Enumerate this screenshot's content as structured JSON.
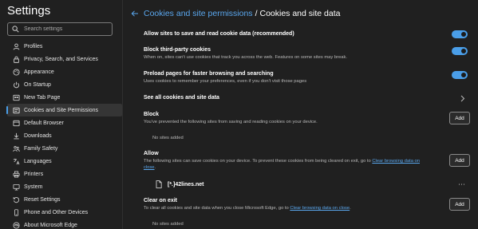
{
  "sidebar": {
    "title": "Settings",
    "search": {
      "placeholder": "Search settings",
      "value": ""
    },
    "items": [
      {
        "label": "Profiles",
        "icon": "profile-icon",
        "active": false
      },
      {
        "label": "Privacy, Search, and Services",
        "icon": "lock-icon",
        "active": false
      },
      {
        "label": "Appearance",
        "icon": "palette-icon",
        "active": false
      },
      {
        "label": "On Startup",
        "icon": "power-icon",
        "active": false
      },
      {
        "label": "New Tab Page",
        "icon": "new-tab-icon",
        "active": false
      },
      {
        "label": "Cookies and Site Permissions",
        "icon": "site-permissions-icon",
        "active": true
      },
      {
        "label": "Default Browser",
        "icon": "browser-icon",
        "active": false
      },
      {
        "label": "Downloads",
        "icon": "download-icon",
        "active": false
      },
      {
        "label": "Family Safety",
        "icon": "family-icon",
        "active": false
      },
      {
        "label": "Languages",
        "icon": "languages-icon",
        "active": false
      },
      {
        "label": "Printers",
        "icon": "printer-icon",
        "active": false
      },
      {
        "label": "System",
        "icon": "system-icon",
        "active": false
      },
      {
        "label": "Reset Settings",
        "icon": "reset-icon",
        "active": false
      },
      {
        "label": "Phone and Other Devices",
        "icon": "phone-icon",
        "active": false
      },
      {
        "label": "About Microsoft Edge",
        "icon": "edge-icon",
        "active": false
      }
    ]
  },
  "header": {
    "parent": "Cookies and site permissions",
    "separator": "/",
    "current": "Cookies and site data"
  },
  "settings": {
    "allow_save": {
      "title": "Allow sites to save and read cookie data (recommended)",
      "enabled": true
    },
    "block_third_party": {
      "title": "Block third-party cookies",
      "desc": "When on, sites can't use cookies that track you across the web. Features on some sites may break.",
      "enabled": true
    },
    "preload": {
      "title": "Preload pages for faster browsing and searching",
      "desc": "Uses cookies to remember your preferences, even if you don't visit those pages",
      "enabled": true
    },
    "see_all": {
      "title": "See all cookies and site data"
    },
    "block": {
      "title": "Block",
      "desc": "You've prevented the following sites from saving and reading cookies on your device.",
      "button": "Add",
      "empty": "No sites added"
    },
    "allow": {
      "title": "Allow",
      "desc_before": "The following sites can save cookies on your device. To prevent these cookies from being cleared on exit, go to ",
      "desc_link": "Clear browsing data on close",
      "desc_after": ".",
      "button": "Add",
      "sites": [
        "[*.]42lines.net"
      ],
      "more": "⋯"
    },
    "clear_on_exit": {
      "title": "Clear on exit",
      "desc_before": "To clear all cookies and site data when you close Microsoft Edge, go to ",
      "desc_link": "Clear browsing data on close",
      "desc_after": ".",
      "button": "Add",
      "empty": "No sites added"
    }
  },
  "colors": {
    "accent": "#4a9ee8",
    "link": "#5aa7ee",
    "background": "#202020"
  }
}
